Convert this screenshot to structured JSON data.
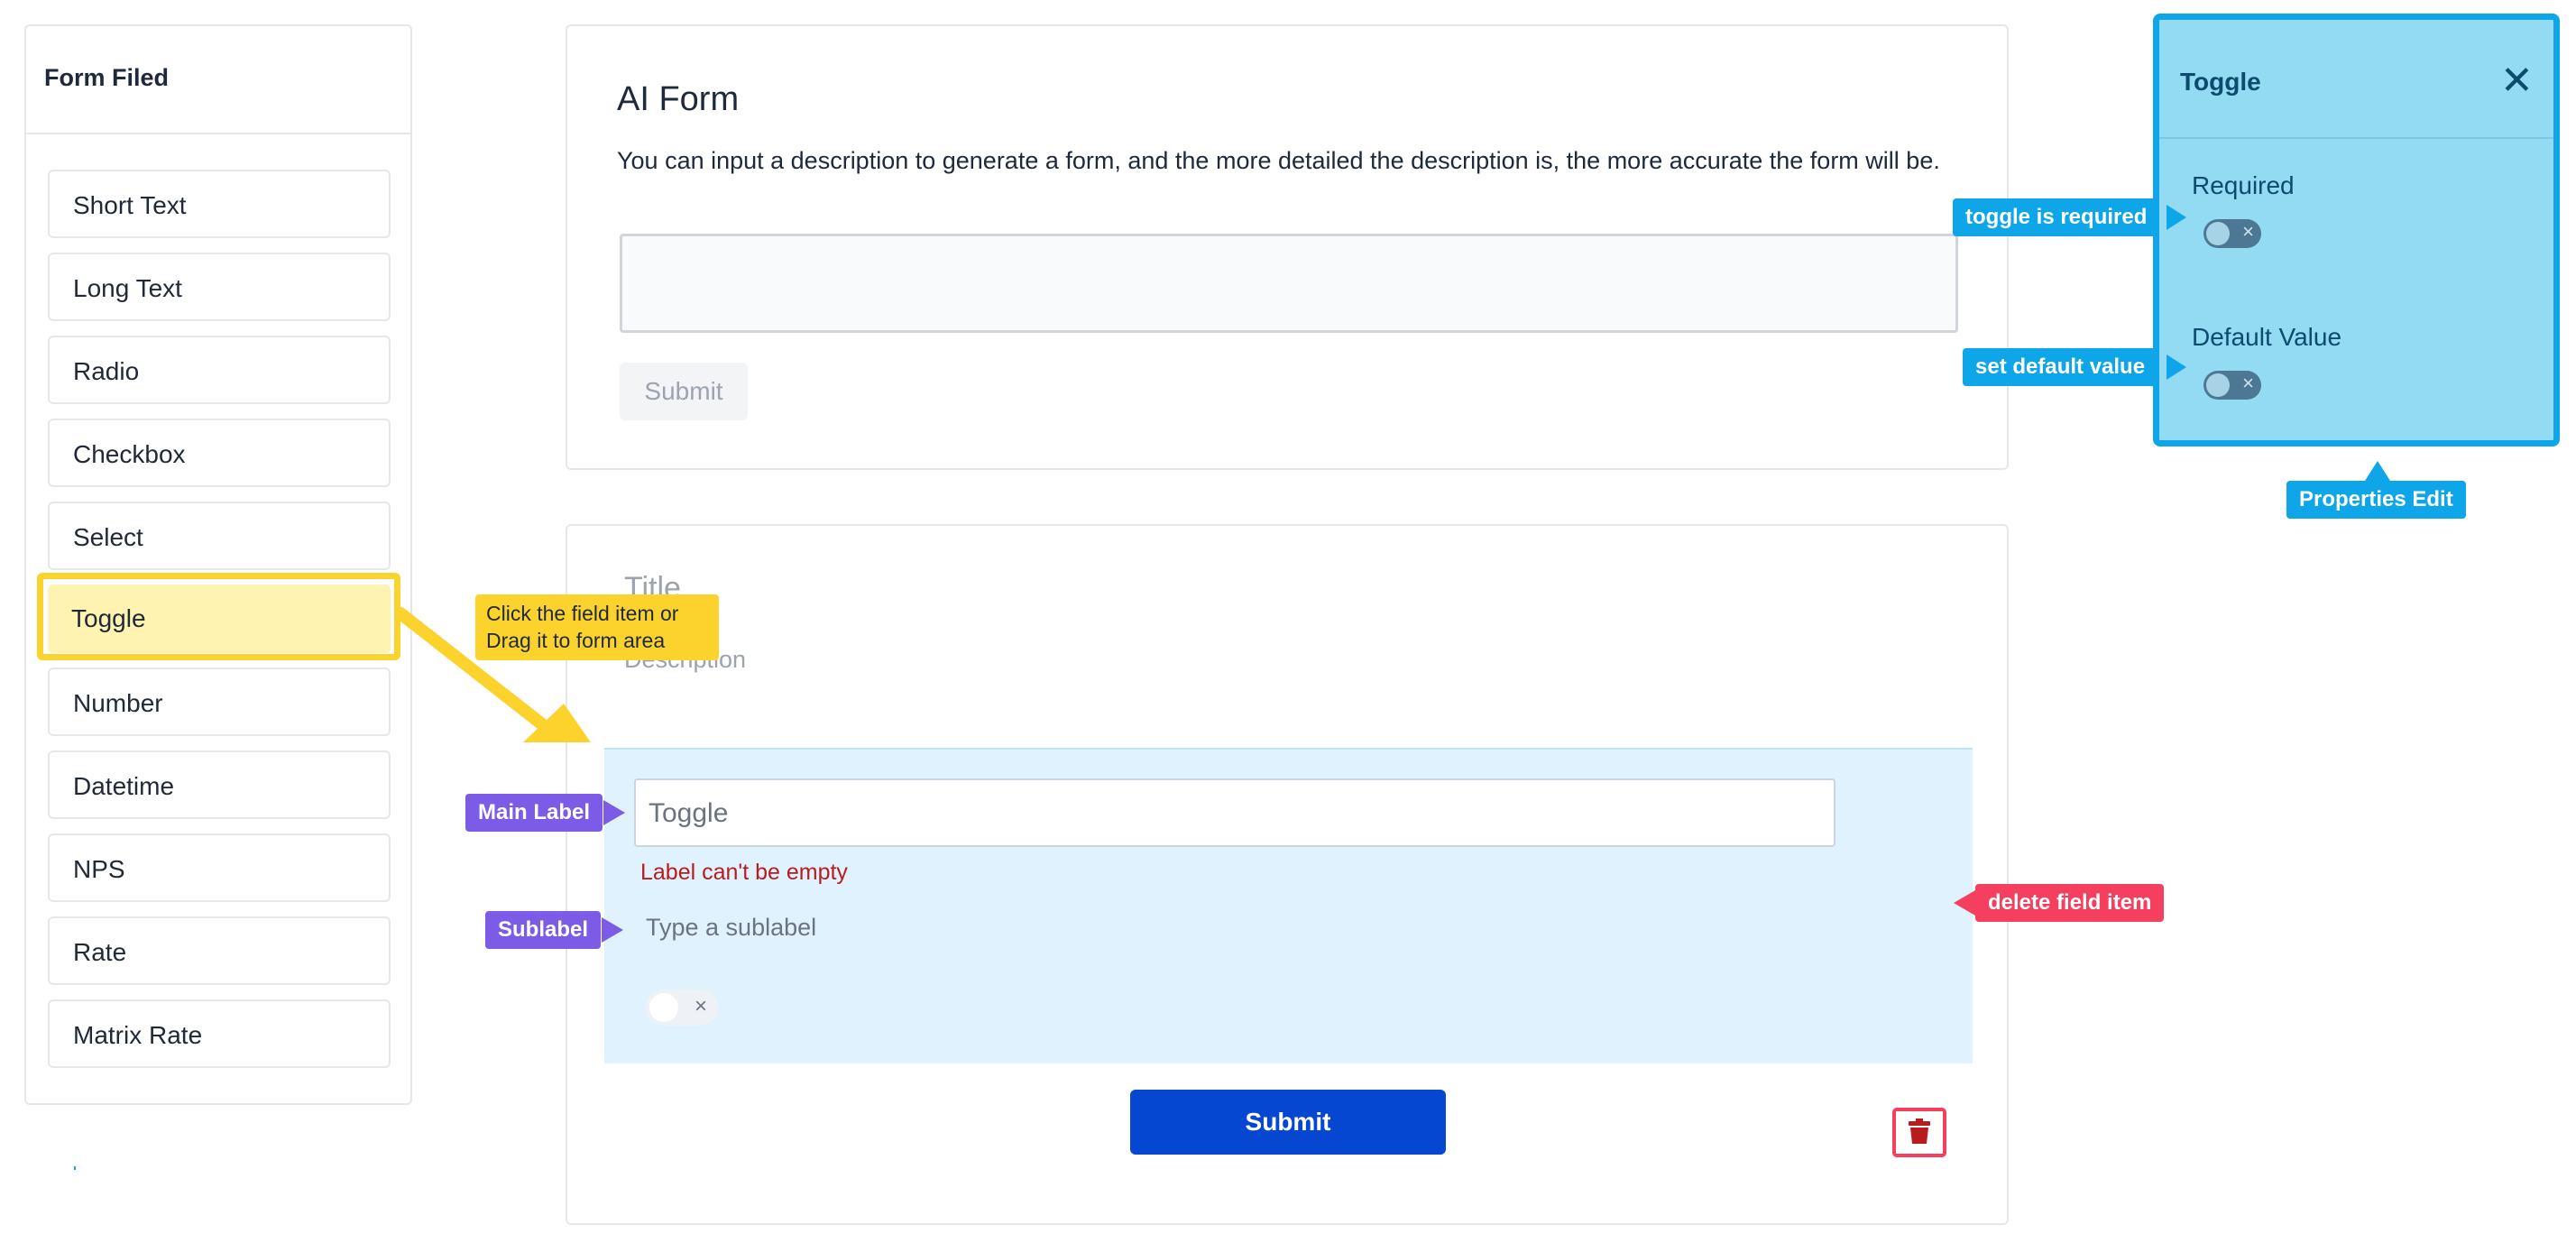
{
  "sidebar": {
    "title": "Form Filed",
    "items": [
      {
        "label": "Short Text"
      },
      {
        "label": "Long Text"
      },
      {
        "label": "Radio"
      },
      {
        "label": "Checkbox"
      },
      {
        "label": "Select"
      },
      {
        "label": "Toggle",
        "active": true
      },
      {
        "label": "Number"
      },
      {
        "label": "Datetime"
      },
      {
        "label": "NPS"
      },
      {
        "label": "Rate"
      },
      {
        "label": "Matrix Rate"
      }
    ]
  },
  "ai_form": {
    "title": "AI Form",
    "description": "You can input a description to generate a form, and the more detailed the description is, the more accurate the form will be.",
    "textarea_value": "",
    "submit_label": "Submit"
  },
  "form": {
    "title": "Title",
    "description": "Description",
    "field": {
      "main_label_value": "Toggle",
      "error": "Label can't be empty",
      "sublabel_placeholder": "Type a sublabel",
      "toggle_symbol": "×"
    },
    "submit_label": "Submit"
  },
  "properties": {
    "title": "Toggle",
    "close_symbol": "✕",
    "required_label": "Required",
    "default_value_label": "Default Value",
    "toggle_symbol": "×"
  },
  "annotations": {
    "toggle_required": "toggle is required",
    "set_default": "set default value",
    "properties_edit": "Properties Edit",
    "drag_hint": "Click the field item or Drag it to form area",
    "main_label": "Main Label",
    "sublabel": "Sublabel",
    "delete_item": "delete field item"
  },
  "colors": {
    "highlight_yellow": "#fcd32d",
    "callout_blue": "#0ea5e9",
    "callout_purple": "#7c5ce6",
    "callout_red": "#f43f5e",
    "primary_button": "#0647d1",
    "field_block_bg": "#e0f2fe"
  },
  "icons": {
    "delete": "trash-icon",
    "close": "close-icon",
    "toggle": "toggle-switch"
  }
}
